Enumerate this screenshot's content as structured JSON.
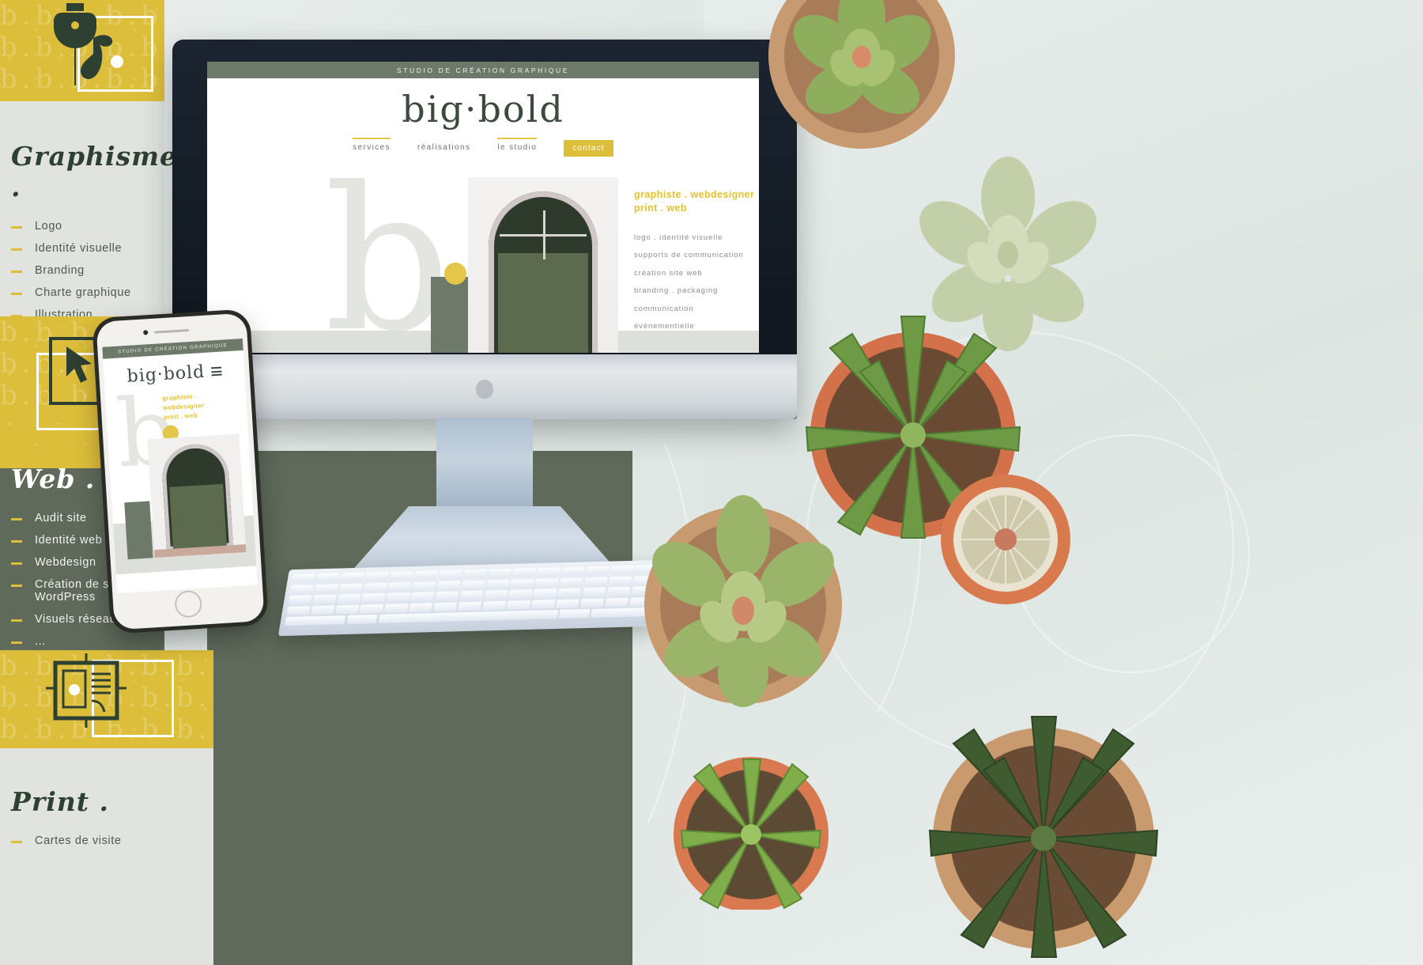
{
  "meta": {
    "accent_yellow": "#ddbe3a",
    "olive": "#5f6a5b",
    "dark_green": "#2e4032",
    "pale_gray": "#e0e3de"
  },
  "sections": [
    {
      "id": "graphisme",
      "title": "Graphisme .",
      "items": [
        "Logo",
        "Identité visuelle",
        "Branding",
        "Charte graphique",
        "Illustration",
        "..."
      ]
    },
    {
      "id": "web",
      "title": "Web .",
      "items": [
        "Audit site",
        "Identité web",
        "Webdesign",
        "Création de site WordPress",
        "Visuels réseaux",
        "..."
      ]
    },
    {
      "id": "print",
      "title": "Print .",
      "items": [
        "Cartes de visite"
      ]
    }
  ],
  "website": {
    "top_bar": "STUDIO DE CRÉATION GRAPHIQUE",
    "logo": "big·bold",
    "nav": [
      {
        "label": "services",
        "underline": true,
        "button": false
      },
      {
        "label": "réalisations",
        "underline": false,
        "button": false
      },
      {
        "label": "le studio",
        "underline": true,
        "button": false
      },
      {
        "label": "contact",
        "underline": false,
        "button": true
      }
    ],
    "hero_letter": "b.",
    "kicker_line_1": "graphiste . webdesigner",
    "kicker_line_2": "print . web",
    "services": [
      "logo . identité visuelle",
      "supports de communication",
      "création site web",
      "branding . packaging",
      "communication",
      "évènementielle"
    ]
  },
  "phone": {
    "top_bar": "STUDIO DE CRÉATION GRAPHIQUE",
    "logo": "big·bold",
    "kicker_line_1": "graphiste .",
    "kicker_line_2": "webdesigner",
    "kicker_line_3": "print . web"
  },
  "icons": {
    "pen_nib": "pen-nib-icon",
    "cursor": "cursor-arrow-icon",
    "brochure": "brochure-icon",
    "menu": "hamburger-menu-icon"
  }
}
